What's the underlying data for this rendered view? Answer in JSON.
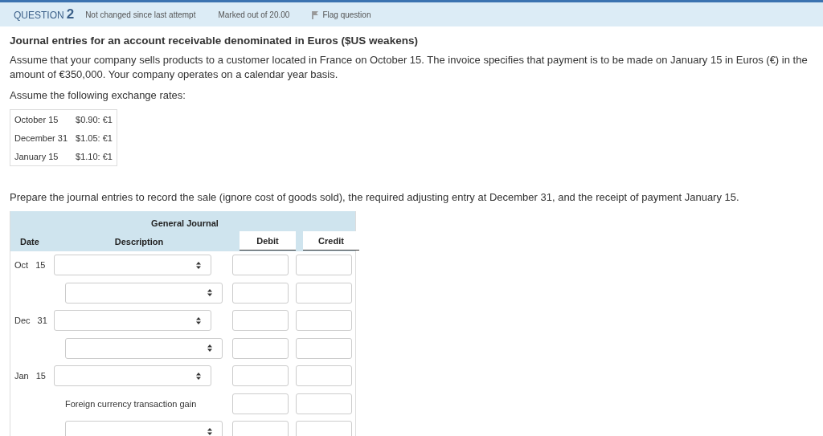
{
  "header": {
    "label": "QUESTION",
    "number": "2",
    "status": "Not changed since last attempt",
    "marks": "Marked out of 20.00",
    "flag": {
      "label": "Flag question",
      "flagged": false
    }
  },
  "title": "Journal entries for an account receivable denominated in Euros ($US weakens)",
  "intro": "Assume that your company sells products to a customer located in France on October 15. The invoice specifies that payment is to be made on January 15 in Euros (€) in the amount of €350,000. Your company operates on a calendar year basis.",
  "rates_intro": "Assume the following exchange rates:",
  "rates": [
    {
      "date": "October 15",
      "rate": "$0.90: €1"
    },
    {
      "date": "December 31",
      "rate": "$1.05: €1"
    },
    {
      "date": "January 15",
      "rate": "$1.10: €1"
    }
  ],
  "instruction": "Prepare the journal entries to record the sale (ignore cost of goods sold), the required adjusting entry at December 31, and the receipt of payment January 15.",
  "journal": {
    "title": "General Journal",
    "columns": [
      "Date",
      "Description",
      "Debit",
      "Credit"
    ],
    "rows": [
      {
        "month": "Oct",
        "day": "15",
        "kind": "debit-select"
      },
      {
        "kind": "credit-select"
      },
      {
        "month": "Dec",
        "day": "31",
        "kind": "debit-select"
      },
      {
        "kind": "credit-select"
      },
      {
        "month": "Jan",
        "day": "15",
        "kind": "debit-select"
      },
      {
        "kind": "text",
        "description": "Foreign currency transaction gain"
      },
      {
        "kind": "credit-select"
      }
    ]
  }
}
